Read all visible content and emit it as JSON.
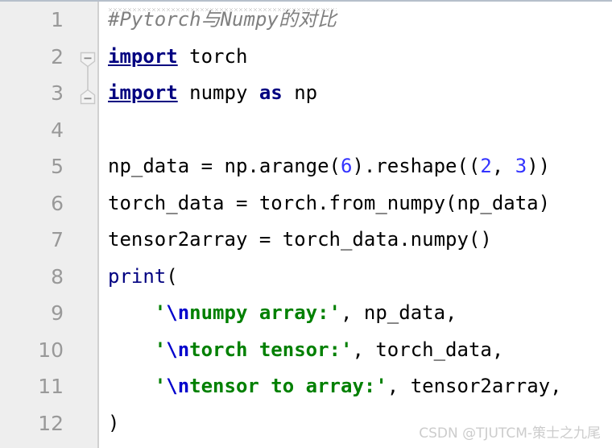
{
  "editor": {
    "language": "python",
    "gutter_bg": "#eeeeee",
    "code_bg": "#ffffff",
    "line_count": 12,
    "line_numbers": [
      "1",
      "2",
      "3",
      "4",
      "5",
      "6",
      "7",
      "8",
      "9",
      "10",
      "11",
      "12"
    ],
    "fold_markers": [
      {
        "line": 2,
        "type": "fold-start-icon",
        "glyph": "minus"
      },
      {
        "line": 3,
        "type": "fold-end-icon",
        "glyph": "minus"
      }
    ],
    "lines": [
      {
        "number": "1",
        "text": "#Pytorch与Numpy的对比",
        "tokens": [
          {
            "t": "#Pytorch与Numpy的对比",
            "c": "comment"
          }
        ]
      },
      {
        "number": "2",
        "text": "import torch",
        "tokens": [
          {
            "t": "import",
            "c": "kw-underline"
          },
          {
            "t": " torch",
            "c": "plain"
          }
        ]
      },
      {
        "number": "3",
        "text": "import numpy as np",
        "tokens": [
          {
            "t": "import",
            "c": "kw-underline"
          },
          {
            "t": " numpy ",
            "c": "plain"
          },
          {
            "t": "as",
            "c": "kw"
          },
          {
            "t": " np",
            "c": "plain"
          }
        ]
      },
      {
        "number": "4",
        "text": "",
        "tokens": []
      },
      {
        "number": "5",
        "text": "np_data = np.arange(6).reshape((2, 3))",
        "tokens": [
          {
            "t": "np_data = np.arange(",
            "c": "plain"
          },
          {
            "t": "6",
            "c": "num"
          },
          {
            "t": ").reshape((",
            "c": "plain"
          },
          {
            "t": "2",
            "c": "num"
          },
          {
            "t": ", ",
            "c": "plain"
          },
          {
            "t": "3",
            "c": "num"
          },
          {
            "t": "))",
            "c": "plain"
          }
        ]
      },
      {
        "number": "6",
        "text": "torch_data = torch.from_numpy(np_data)",
        "tokens": [
          {
            "t": "torch_data = torch.from_numpy(np_data)",
            "c": "plain"
          }
        ]
      },
      {
        "number": "7",
        "text": "tensor2array = torch_data.numpy()",
        "tokens": [
          {
            "t": "tensor2array = torch_data.numpy()",
            "c": "plain"
          }
        ]
      },
      {
        "number": "8",
        "text": "print(",
        "tokens": [
          {
            "t": "print",
            "c": "builtin"
          },
          {
            "t": "(",
            "c": "plain"
          }
        ]
      },
      {
        "number": "9",
        "text": "    '\\nnumpy array:', np_data,",
        "tokens": [
          {
            "t": "    '",
            "c": "str"
          },
          {
            "t": "\\n",
            "c": "esc"
          },
          {
            "t": "numpy array:'",
            "c": "str"
          },
          {
            "t": ", np_data,",
            "c": "plain"
          }
        ]
      },
      {
        "number": "10",
        "text": "    '\\ntorch tensor:', torch_data,",
        "tokens": [
          {
            "t": "    '",
            "c": "str"
          },
          {
            "t": "\\n",
            "c": "esc"
          },
          {
            "t": "torch tensor:'",
            "c": "str"
          },
          {
            "t": ", torch_data,",
            "c": "plain"
          }
        ]
      },
      {
        "number": "11",
        "text": "    '\\ntensor to array:', tensor2array,",
        "tokens": [
          {
            "t": "    '",
            "c": "str"
          },
          {
            "t": "\\n",
            "c": "esc"
          },
          {
            "t": "tensor to array:'",
            "c": "str"
          },
          {
            "t": ", tensor2array,",
            "c": "plain"
          }
        ]
      },
      {
        "number": "12",
        "text": ")",
        "tokens": [
          {
            "t": ")",
            "c": "plain"
          }
        ]
      }
    ],
    "colors": {
      "keyword": "#000080",
      "builtin": "#000080",
      "number": "#3333ff",
      "string": "#008000",
      "escape": "#0000cc",
      "comment": "#808080",
      "plain": "#000000",
      "line_number": "#999999"
    }
  },
  "watermark": {
    "text": "CSDN @TJUTCM-策士之九尾"
  }
}
